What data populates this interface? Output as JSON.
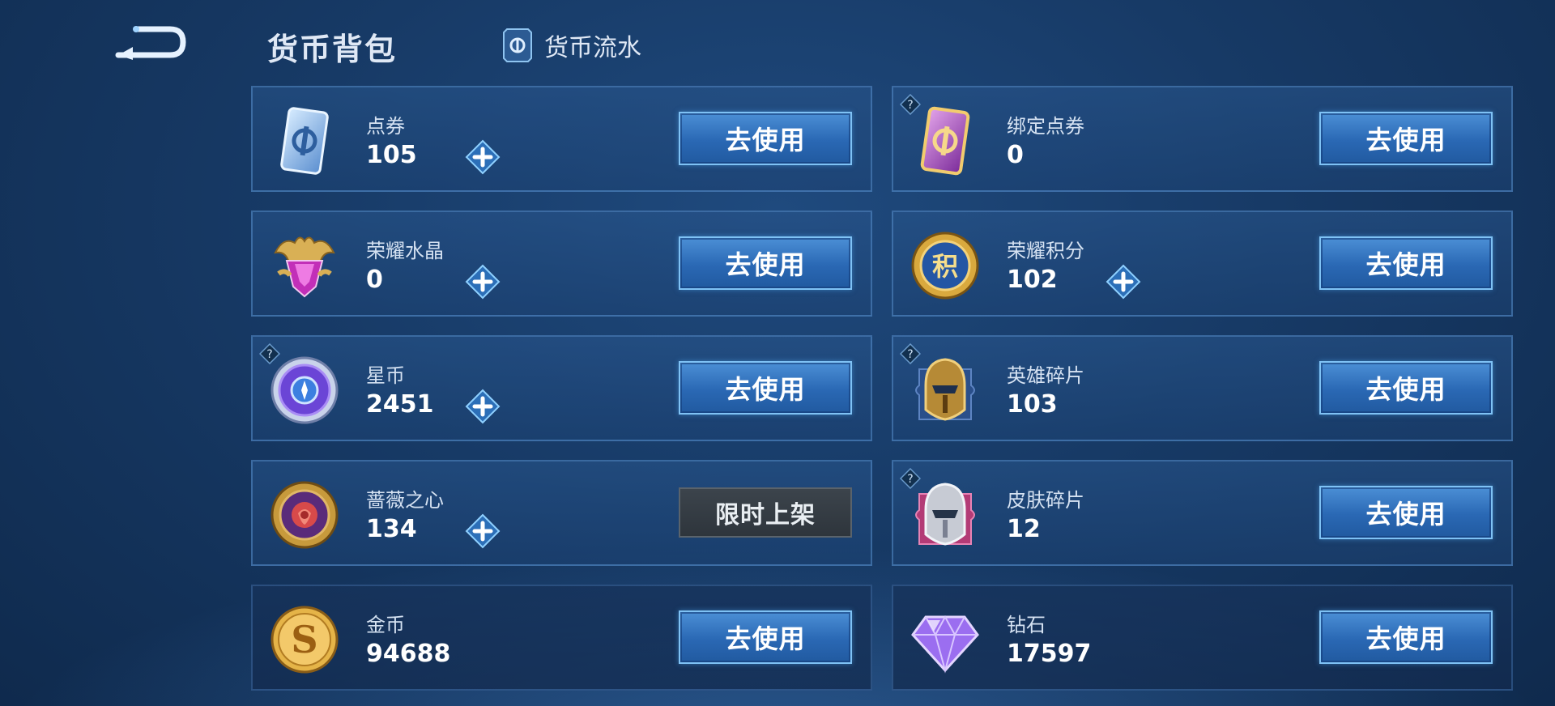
{
  "header": {
    "title": "货币背包",
    "flow_label": "货币流水"
  },
  "currencies": [
    {
      "name": "点券",
      "amount": "105",
      "action": "去使用",
      "icon": "coupon-card-icon"
    },
    {
      "name": "绑定点券",
      "amount": "0",
      "action": "去使用",
      "icon": "bound-coupon-card-icon"
    },
    {
      "name": "荣耀水晶",
      "amount": "0",
      "action": "去使用",
      "icon": "glory-crystal-icon"
    },
    {
      "name": "荣耀积分",
      "amount": "102",
      "action": "去使用",
      "icon": "glory-points-icon",
      "icon_text": "积"
    },
    {
      "name": "星币",
      "amount": "2451",
      "action": "去使用",
      "icon": "star-coin-icon"
    },
    {
      "name": "英雄碎片",
      "amount": "103",
      "action": "去使用",
      "icon": "hero-fragment-icon"
    },
    {
      "name": "蔷薇之心",
      "amount": "134",
      "action": "限时上架",
      "icon": "rose-heart-icon"
    },
    {
      "name": "皮肤碎片",
      "amount": "12",
      "action": "去使用",
      "icon": "skin-fragment-icon"
    },
    {
      "name": "金币",
      "amount": "94688",
      "action": "去使用",
      "icon": "gold-coin-icon",
      "icon_text": "S"
    },
    {
      "name": "钻石",
      "amount": "17597",
      "action": "去使用",
      "icon": "diamond-icon"
    }
  ],
  "colors": {
    "button": "#2a68b4",
    "button_border": "#7fc2f5",
    "disabled_button": "#2e353c"
  }
}
